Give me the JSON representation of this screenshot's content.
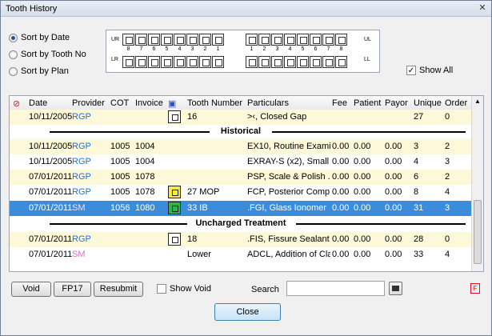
{
  "window": {
    "title": "Tooth History"
  },
  "sort_options": [
    {
      "label": "Sort by Date",
      "checked": true
    },
    {
      "label": "Sort by Tooth No",
      "checked": false
    },
    {
      "label": "Sort by Plan",
      "checked": false
    }
  ],
  "tooth_chart": {
    "quadrants": {
      "ur": "UR",
      "ul": "UL",
      "lr": "LR",
      "ll": "LL"
    },
    "numbers_left": [
      "8",
      "7",
      "6",
      "5",
      "4",
      "3",
      "2",
      "1"
    ],
    "numbers_right": [
      "1",
      "2",
      "3",
      "4",
      "5",
      "6",
      "7",
      "8"
    ]
  },
  "show_all": {
    "label": "Show All",
    "checked": true
  },
  "columns": {
    "date": "Date",
    "provider": "Provider",
    "cot": "COT",
    "invoice": "Invoice",
    "tooth_number": "Tooth Number",
    "particulars": "Particulars",
    "fee": "Fee",
    "patient": "Patient",
    "payor": "Payor",
    "unique": "Unique",
    "order": "Order"
  },
  "rows": [
    {
      "date": "10/11/2005",
      "provider": "RGP",
      "cot": "",
      "invoice": "",
      "tooth": "16",
      "particulars": ">‹,     Closed Gap",
      "fee": "",
      "patient": "",
      "payor": "",
      "unique": "27",
      "order": "0"
    },
    {
      "date": "10/11/2005",
      "provider": "RGP",
      "cot": "1005",
      "invoice": "1004",
      "tooth": "",
      "particulars": "EX10, Routine Exami...",
      "fee": "0.00",
      "patient": "0.00",
      "payor": "0.00",
      "unique": "3",
      "order": "2"
    },
    {
      "date": "10/11/2005",
      "provider": "RGP",
      "cot": "1005",
      "invoice": "1004",
      "tooth": "",
      "particulars": "EXRAY-S (x2), Small ...",
      "fee": "0.00",
      "patient": "0.00",
      "payor": "0.00",
      "unique": "4",
      "order": "3"
    },
    {
      "date": "07/01/2011",
      "provider": "RGP",
      "cot": "1005",
      "invoice": "1078",
      "tooth": "",
      "particulars": "PSP, Scale & Polish ...",
      "fee": "0.00",
      "patient": "0.00",
      "payor": "0.00",
      "unique": "6",
      "order": "2"
    },
    {
      "date": "07/01/2011",
      "provider": "RGP",
      "cot": "1005",
      "invoice": "1078",
      "tooth": "27 MOP",
      "particulars": "FCP, Posterior Comp...",
      "fee": "0.00",
      "patient": "0.00",
      "payor": "0.00",
      "unique": "8",
      "order": "4"
    },
    {
      "date": "07/01/2011",
      "provider": "SM",
      "cot": "1056",
      "invoice": "1080",
      "tooth": "33 IB",
      "particulars": ".FGI,     Glass Ionomer",
      "fee": "0.00",
      "patient": "0.00",
      "payor": "0.00",
      "unique": "31",
      "order": "3"
    },
    {
      "date": "07/01/2011",
      "provider": "RGP",
      "cot": "",
      "invoice": "",
      "tooth": "18",
      "particulars": ".FIS,     Fissure Sealant",
      "fee": "0.00",
      "patient": "0.00",
      "payor": "0.00",
      "unique": "28",
      "order": "0"
    },
    {
      "date": "07/01/2011",
      "provider": "SM",
      "cot": "",
      "invoice": "",
      "tooth": "Lower",
      "particulars": "ADCL, Addition of Cla...",
      "fee": "0.00",
      "patient": "0.00",
      "payor": "0.00",
      "unique": "33",
      "order": "4"
    }
  ],
  "sections": {
    "historical": "Historical",
    "uncharged": "Uncharged Treatment"
  },
  "buttons": {
    "void": "Void",
    "fp17": "FP17",
    "resubmit": "Resubmit",
    "close": "Close"
  },
  "show_void": {
    "label": "Show Void",
    "checked": false
  },
  "search": {
    "label": "Search",
    "value": ""
  },
  "filter_icon_text": "F",
  "colors": {
    "selected_row": "#3b8ddc",
    "alt_row": "#fdf8d8",
    "provider_rgp": "#1f6fd6",
    "provider_sm": "#e86cc9"
  }
}
